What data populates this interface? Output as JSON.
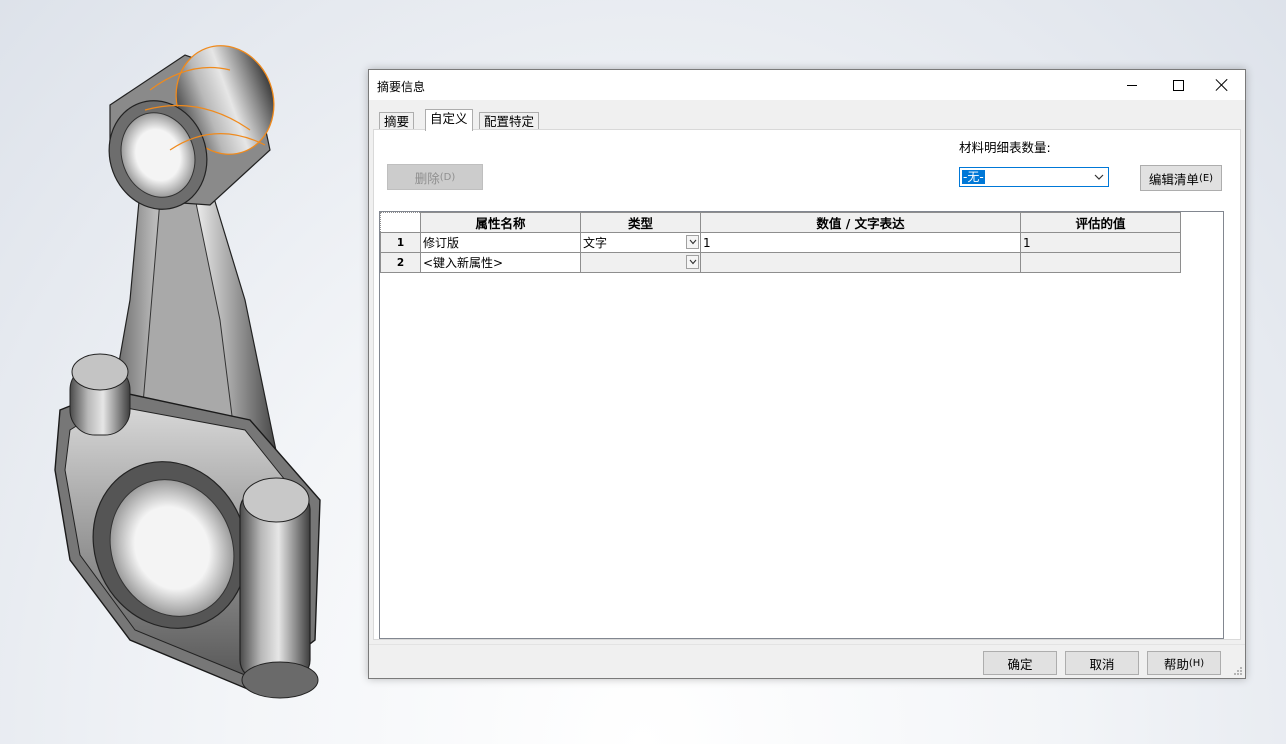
{
  "dialog": {
    "title": "摘要信息",
    "tabs": [
      {
        "label": "摘要"
      },
      {
        "label": "自定义",
        "active": true
      },
      {
        "label": "配置特定"
      }
    ],
    "delete_button": {
      "label": "删除",
      "shortcut": "(D)",
      "enabled": false
    },
    "bom_quantity": {
      "label": "材料明细表数量:",
      "selected": "-无-"
    },
    "edit_list_button": {
      "label": "编辑清单",
      "shortcut": "(E)"
    },
    "grid": {
      "columns": [
        "属性名称",
        "类型",
        "数值 / 文字表达",
        "评估的值"
      ],
      "rows": [
        {
          "num": "1",
          "name": "修订版",
          "type": "文字",
          "value": "1",
          "evaluated": "1"
        },
        {
          "num": "2",
          "name": "<键入新属性>",
          "type": "",
          "value": "",
          "evaluated": ""
        }
      ]
    },
    "footer": {
      "ok_label": "确定",
      "cancel_label": "取消",
      "help_label": "帮助",
      "help_shortcut": "(H)"
    }
  },
  "colors": {
    "accent": "#0078d7",
    "selection_edge": "#f08a1c",
    "dialog_bg": "#f0f0f0"
  },
  "icons": [
    "minimize-icon",
    "maximize-icon",
    "close-icon",
    "dropdown-arrow-icon",
    "resize-grip-icon"
  ]
}
